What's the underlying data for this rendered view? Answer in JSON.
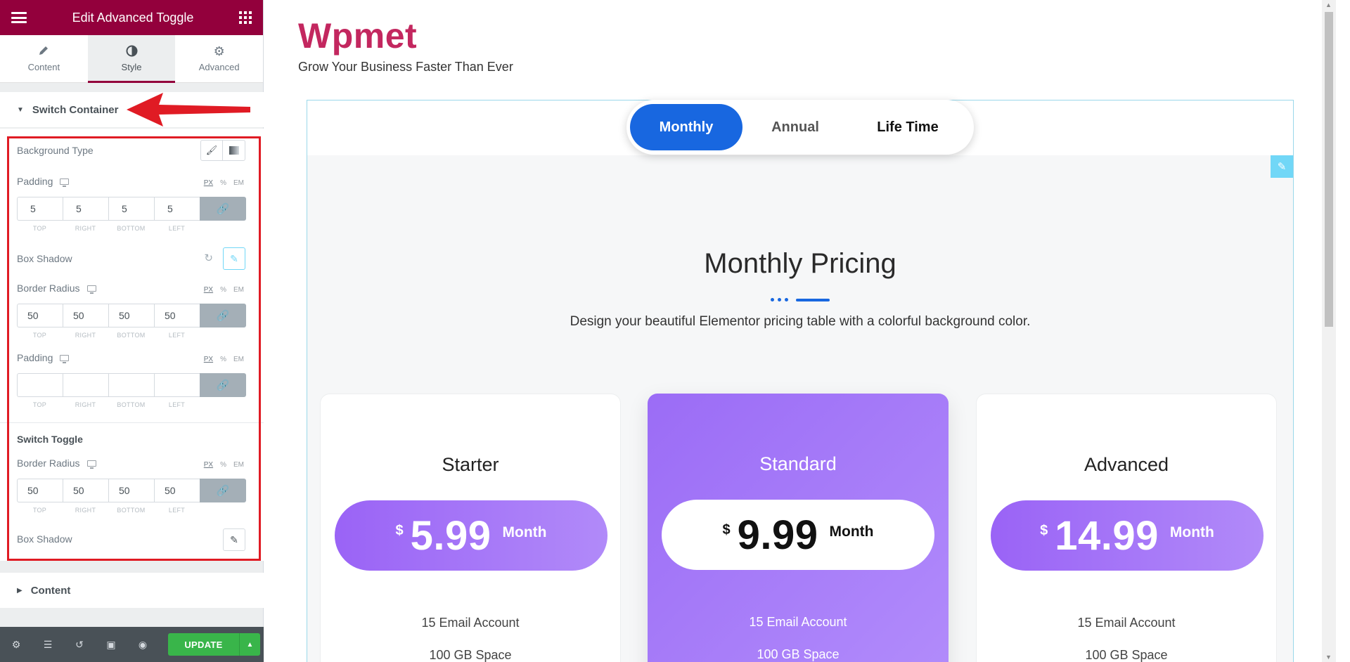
{
  "panel": {
    "title": "Edit Advanced Toggle",
    "tabs": [
      {
        "label": "Content",
        "icon": "pencil-icon"
      },
      {
        "label": "Style",
        "icon": "contrast-icon"
      },
      {
        "label": "Advanced",
        "icon": "gear-icon"
      }
    ],
    "active_tab": "Style",
    "switch_container": {
      "heading": "Switch Container",
      "background_type_label": "Background Type",
      "padding1": {
        "label": "Padding",
        "units": [
          "PX",
          "%",
          "EM"
        ],
        "values": [
          "5",
          "5",
          "5",
          "5"
        ],
        "sublabels": [
          "TOP",
          "RIGHT",
          "BOTTOM",
          "LEFT"
        ]
      },
      "box_shadow_label": "Box Shadow",
      "border_radius": {
        "label": "Border Radius",
        "units": [
          "PX",
          "%",
          "EM"
        ],
        "values": [
          "50",
          "50",
          "50",
          "50"
        ],
        "sublabels": [
          "TOP",
          "RIGHT",
          "BOTTOM",
          "LEFT"
        ]
      },
      "padding2": {
        "label": "Padding",
        "units": [
          "PX",
          "%",
          "EM"
        ],
        "values": [
          "",
          "",
          "",
          ""
        ],
        "sublabels": [
          "TOP",
          "RIGHT",
          "BOTTOM",
          "LEFT"
        ]
      },
      "switch_toggle_heading": "Switch Toggle",
      "toggle_border_radius": {
        "label": "Border Radius",
        "units": [
          "PX",
          "%",
          "EM"
        ],
        "values": [
          "50",
          "50",
          "50",
          "50"
        ],
        "sublabels": [
          "TOP",
          "RIGHT",
          "BOTTOM",
          "LEFT"
        ]
      },
      "toggle_box_shadow_label": "Box Shadow"
    },
    "content_section": "Content",
    "footer": {
      "update_label": "UPDATE"
    }
  },
  "preview": {
    "brand": "Wpmet",
    "tagline": "Grow Your Business Faster Than Ever",
    "switch_options": [
      "Monthly",
      "Annual",
      "Life Time"
    ],
    "active_option": "Monthly",
    "pricing_title": "Monthly Pricing",
    "pricing_desc": "Design your beautiful Elementor pricing table with a colorful background color.",
    "plans": [
      {
        "name": "Starter",
        "currency": "$",
        "price": "5.99",
        "period": "Month",
        "features": [
          "15 Email Account",
          "100 GB Space"
        ]
      },
      {
        "name": "Standard",
        "currency": "$",
        "price": "9.99",
        "period": "Month",
        "features": [
          "15 Email Account",
          "100 GB Space"
        ]
      },
      {
        "name": "Advanced",
        "currency": "$",
        "price": "14.99",
        "period": "Month",
        "features": [
          "15 Email Account",
          "100 GB Space"
        ]
      }
    ]
  },
  "colors": {
    "panel_header": "#93003c",
    "brand": "#c3275f",
    "switch_active": "#1867e0",
    "plan_purple": "#9b6cf6",
    "update_green": "#39b54a",
    "highlight_red": "#e01b24"
  }
}
